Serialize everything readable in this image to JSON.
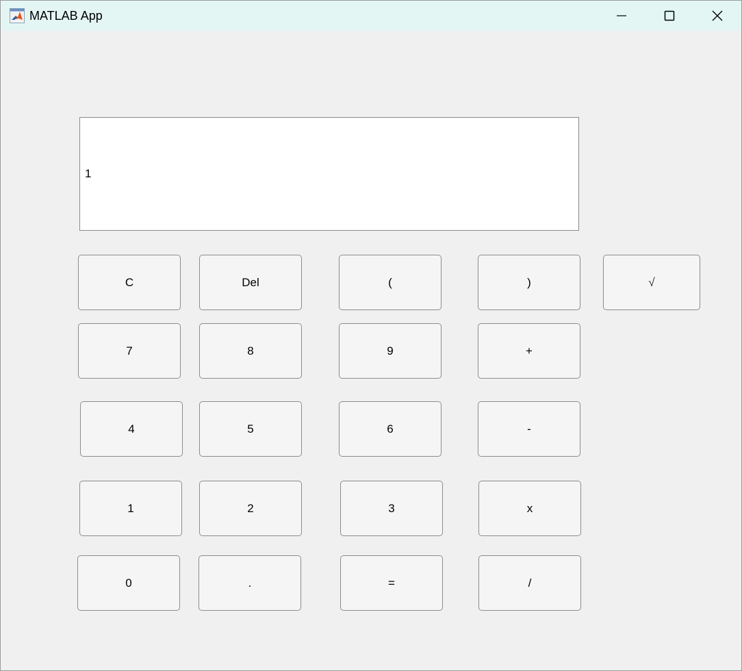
{
  "window": {
    "title": "MATLAB App",
    "icon": "matlab-logo-icon",
    "controls": [
      "minimize-icon",
      "maximize-icon",
      "close-icon"
    ]
  },
  "display": {
    "value": "1"
  },
  "buttons": {
    "clear": "C",
    "delete": "Del",
    "open_paren": "(",
    "close_paren": ")",
    "sqrt": "√",
    "seven": "7",
    "eight": "8",
    "nine": "9",
    "plus": "+",
    "four": "4",
    "five": "5",
    "six": "6",
    "minus": "-",
    "one": "1",
    "two": "2",
    "three": "3",
    "multiply": "x",
    "zero": "0",
    "decimal": ".",
    "equals": "=",
    "divide": "/"
  },
  "colors": {
    "titlebar": "#e3f6f4",
    "window_bg": "#f0f0f0",
    "button_bg": "#f5f5f5",
    "button_border": "#8c8c8c"
  }
}
